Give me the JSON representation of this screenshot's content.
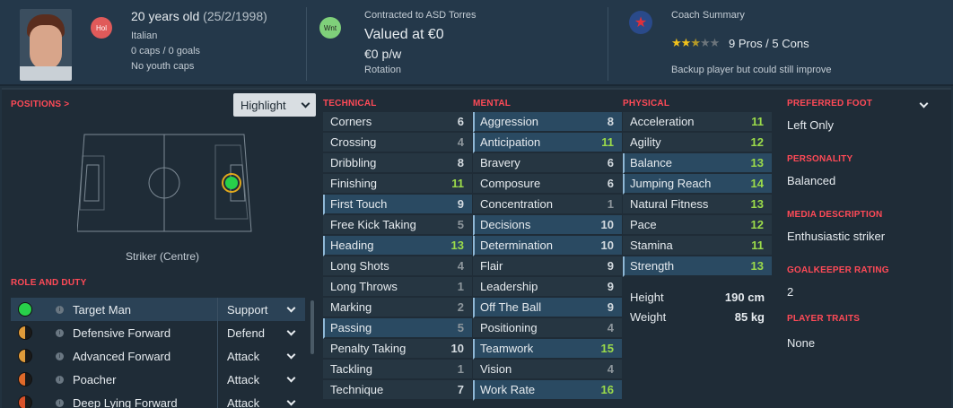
{
  "header": {
    "age": "20 years old",
    "dob": "(25/2/1998)",
    "nationality": "Italian",
    "caps": "0 caps / 0 goals",
    "youth": "No youth caps",
    "nat_badge": "Hol",
    "club_badge": "Wnt",
    "contract": "Contracted to ASD Torres",
    "value": "Valued at €0",
    "wage": "€0 p/w",
    "status": "Rotation",
    "coach_title": "Coach Summary",
    "rating_stars": 2.5,
    "pros_cons": "9 Pros / 5 Cons",
    "coach_note": "Backup player but could still improve"
  },
  "positions": {
    "title": "POSITIONS >",
    "view": "Highlight",
    "position_label": "Striker (Centre)"
  },
  "roles": {
    "title": "ROLE AND DUTY",
    "items": [
      {
        "name": "Target Man",
        "duty": "Support",
        "color": "#28d04a"
      },
      {
        "name": "Defensive Forward",
        "duty": "Defend",
        "color": "#e09b3a"
      },
      {
        "name": "Advanced Forward",
        "duty": "Attack",
        "color": "#e09b3a"
      },
      {
        "name": "Poacher",
        "duty": "Attack",
        "color": "#e06a2a"
      },
      {
        "name": "Deep Lying Forward",
        "duty": "Attack",
        "color": "#d9522a"
      }
    ]
  },
  "technical": {
    "title": "TECHNICAL",
    "items": [
      {
        "name": "Corners",
        "value": "6",
        "hl": false
      },
      {
        "name": "Crossing",
        "value": "4",
        "hl": false
      },
      {
        "name": "Dribbling",
        "value": "8",
        "hl": false
      },
      {
        "name": "Finishing",
        "value": "11",
        "hl": false
      },
      {
        "name": "First Touch",
        "value": "9",
        "hl": true
      },
      {
        "name": "Free Kick Taking",
        "value": "5",
        "hl": false
      },
      {
        "name": "Heading",
        "value": "13",
        "hl": true
      },
      {
        "name": "Long Shots",
        "value": "4",
        "hl": false
      },
      {
        "name": "Long Throws",
        "value": "1",
        "hl": false
      },
      {
        "name": "Marking",
        "value": "2",
        "hl": false
      },
      {
        "name": "Passing",
        "value": "5",
        "hl": true
      },
      {
        "name": "Penalty Taking",
        "value": "10",
        "hl": false
      },
      {
        "name": "Tackling",
        "value": "1",
        "hl": false
      },
      {
        "name": "Technique",
        "value": "7",
        "hl": false
      }
    ]
  },
  "mental": {
    "title": "MENTAL",
    "items": [
      {
        "name": "Aggression",
        "value": "8",
        "hl": true
      },
      {
        "name": "Anticipation",
        "value": "11",
        "hl": true
      },
      {
        "name": "Bravery",
        "value": "6",
        "hl": false
      },
      {
        "name": "Composure",
        "value": "6",
        "hl": false
      },
      {
        "name": "Concentration",
        "value": "1",
        "hl": false
      },
      {
        "name": "Decisions",
        "value": "10",
        "hl": true
      },
      {
        "name": "Determination",
        "value": "10",
        "hl": true
      },
      {
        "name": "Flair",
        "value": "9",
        "hl": false
      },
      {
        "name": "Leadership",
        "value": "9",
        "hl": false
      },
      {
        "name": "Off The Ball",
        "value": "9",
        "hl": true
      },
      {
        "name": "Positioning",
        "value": "4",
        "hl": false
      },
      {
        "name": "Teamwork",
        "value": "15",
        "hl": true
      },
      {
        "name": "Vision",
        "value": "4",
        "hl": false
      },
      {
        "name": "Work Rate",
        "value": "16",
        "hl": true
      }
    ]
  },
  "physical": {
    "title": "PHYSICAL",
    "items": [
      {
        "name": "Acceleration",
        "value": "11",
        "hl": false
      },
      {
        "name": "Agility",
        "value": "12",
        "hl": false
      },
      {
        "name": "Balance",
        "value": "13",
        "hl": true
      },
      {
        "name": "Jumping Reach",
        "value": "14",
        "hl": true
      },
      {
        "name": "Natural Fitness",
        "value": "13",
        "hl": false
      },
      {
        "name": "Pace",
        "value": "12",
        "hl": false
      },
      {
        "name": "Stamina",
        "value": "11",
        "hl": false
      },
      {
        "name": "Strength",
        "value": "13",
        "hl": true
      }
    ],
    "height_label": "Height",
    "height": "190 cm",
    "weight_label": "Weight",
    "weight": "85 kg"
  },
  "info": {
    "foot_title": "PREFERRED FOOT",
    "foot": "Left Only",
    "personality_title": "PERSONALITY",
    "personality": "Balanced",
    "media_title": "MEDIA DESCRIPTION",
    "media": "Enthusiastic striker",
    "gk_title": "GOALKEEPER RATING",
    "gk": "2",
    "traits_title": "PLAYER TRAITS",
    "traits": "None"
  }
}
